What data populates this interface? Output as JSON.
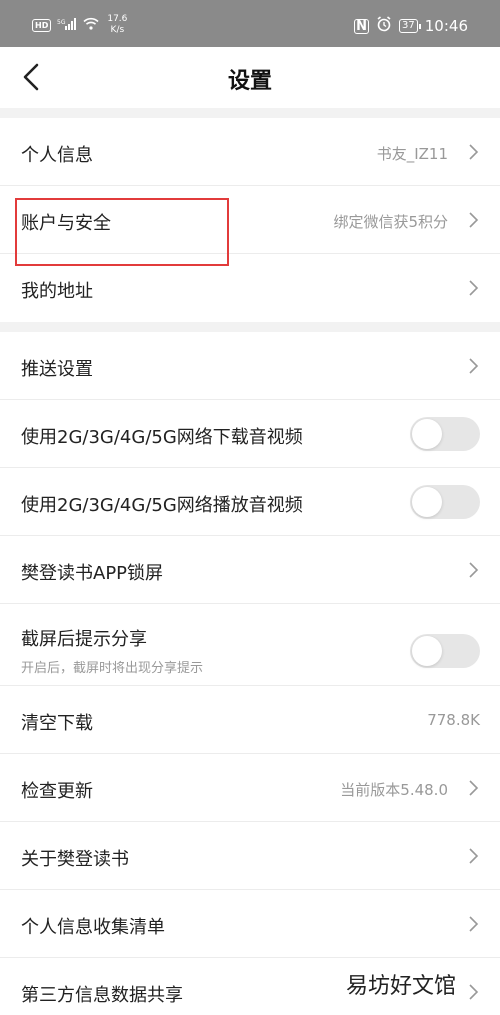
{
  "status_bar": {
    "hd": "HD",
    "net": "5G",
    "speed_value": "17.6",
    "speed_unit": "K/s",
    "nfc": "N",
    "battery": "37",
    "time": "10:46"
  },
  "header": {
    "title": "设置"
  },
  "group1": [
    {
      "label": "个人信息",
      "value": "书友_IZ11"
    },
    {
      "label": "账户与安全",
      "value": "绑定微信获5积分"
    },
    {
      "label": "我的地址",
      "value": ""
    }
  ],
  "group2": {
    "push": {
      "label": "推送设置"
    },
    "download_network": {
      "label": "使用2G/3G/4G/5G网络下载音视频",
      "on": false
    },
    "play_network": {
      "label": "使用2G/3G/4G/5G网络播放音视频",
      "on": false
    },
    "lockscreen": {
      "label": "樊登读书APP锁屏"
    },
    "screenshot_share": {
      "label": "截屏后提示分享",
      "sub": "开启后，截屏时将出现分享提示",
      "on": false
    },
    "clear_download": {
      "label": "清空下载",
      "value": "778.8K"
    },
    "check_update": {
      "label": "检查更新",
      "value": "当前版本5.48.0"
    },
    "about": {
      "label": "关于樊登读书"
    },
    "info_list": {
      "label": "个人信息收集清单"
    },
    "third_party": {
      "label": "第三方信息数据共享"
    }
  },
  "watermark": "易坊好文馆",
  "colors": {
    "highlight": "#e23b3b",
    "toggle_off": "#e6e6e6",
    "status_bar": "#8a8a8a"
  }
}
